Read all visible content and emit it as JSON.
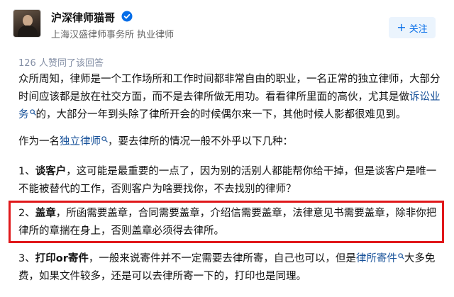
{
  "author": {
    "name": "沪深律师猫哥",
    "bio": "上海汉盛律师事务所 执业律师",
    "verified_icon": "verified-badge-icon",
    "avatar_icon": "avatar"
  },
  "follow_button": {
    "label": "关注",
    "icon": "plus-icon",
    "color": "#056de8"
  },
  "upvote_summary": "126 人赞同了该回答",
  "answer": {
    "p1": {
      "text_a": "众所周知，律师是一个工作场所和工作时间都非常自由的职业，一名正常的独立律师，大部分时间应该都是放在社交方面，而不是去律所做无用功。看看律所里面的高伙，尤其是做",
      "link": "诉讼业务",
      "text_b": "的，大部分一年到头除了律所开会的时候偶尔来一下，其他时候人影都很难见到。"
    },
    "p2": {
      "text_a": "作为一名",
      "link": "独立律师",
      "text_b": "，要去律所的情况一般不外乎以下几种："
    },
    "p3": {
      "prefix": "1、",
      "bold": "谈客户",
      "text": "，这可能是最重要的一点了，因为别的活别人都能帮你给干掉，但是谈客户是唯一不能被替代的工作，否则客户为啥要找你，不去找别的律师？"
    },
    "p4": {
      "prefix": "2、",
      "bold": "盖章",
      "text": "，所函需要盖章，合同需要盖章，介绍信需要盖章，法律意见书需要盖章，除非你把律所的章揣在身上，否则盖章必须得去律所。"
    },
    "p5": {
      "prefix": "3、",
      "bold_a": "打印",
      "mid": "or",
      "bold_b": "寄件",
      "text_a": "，一般来说寄件并不一定需要去律所寄，自己也可以，但是",
      "link": "律所寄件",
      "text_b": "大多免费，如果文件较多，还是可以去律所寄一下的，打印也是同理。"
    }
  },
  "colors": {
    "link": "#175199",
    "highlight_border": "#e0181b",
    "muted": "#8590a6",
    "verified": "#056de8"
  }
}
